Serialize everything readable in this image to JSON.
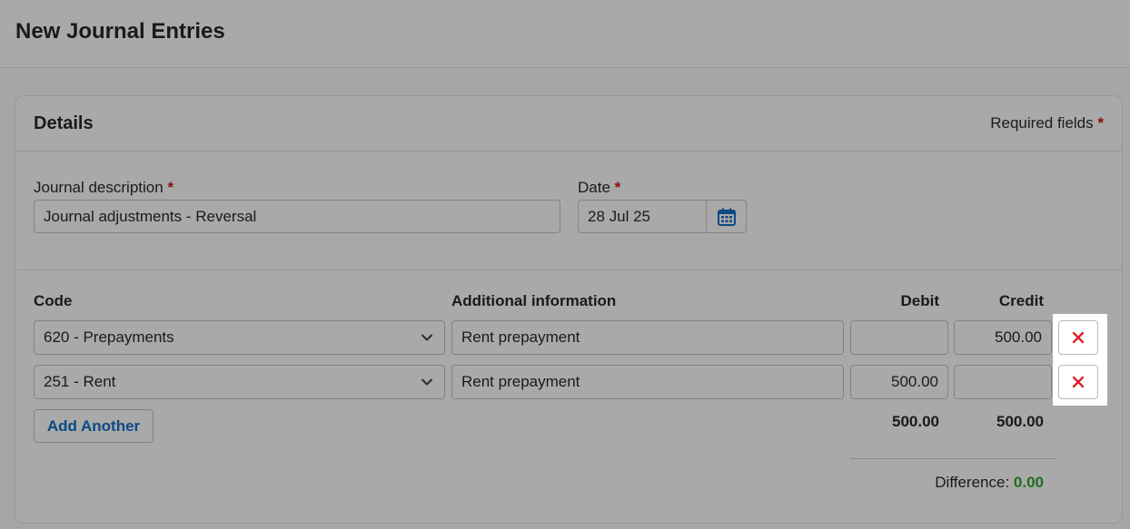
{
  "page": {
    "title": "New Journal Entries"
  },
  "details": {
    "title": "Details",
    "required_note": "Required fields",
    "required_marker": "*"
  },
  "form": {
    "description_label": "Journal description",
    "description_value": "Journal adjustments - Reversal",
    "date_label": "Date",
    "date_value": "28 Jul 25"
  },
  "lines": {
    "headers": {
      "code": "Code",
      "info": "Additional information",
      "debit": "Debit",
      "credit": "Credit"
    },
    "rows": [
      {
        "code": "620 - Prepayments",
        "info": "Rent prepayment",
        "debit": "",
        "credit": "500.00"
      },
      {
        "code": "251 - Rent",
        "info": "Rent prepayment",
        "debit": "500.00",
        "credit": ""
      }
    ],
    "add_label": "Add Another",
    "total_debit": "500.00",
    "total_credit": "500.00",
    "difference_label": "Difference:",
    "difference_value": "0.00"
  },
  "colors": {
    "accent": "#0b4a85",
    "required": "#8c0d0d",
    "remove": "#d9232c",
    "difference_ok": "#1f6e1f",
    "overlay_bg": "#a9a9a9"
  },
  "icons": {
    "date_picker": "calendar-icon",
    "select": "chevron-down-icon",
    "remove": "close-icon"
  }
}
